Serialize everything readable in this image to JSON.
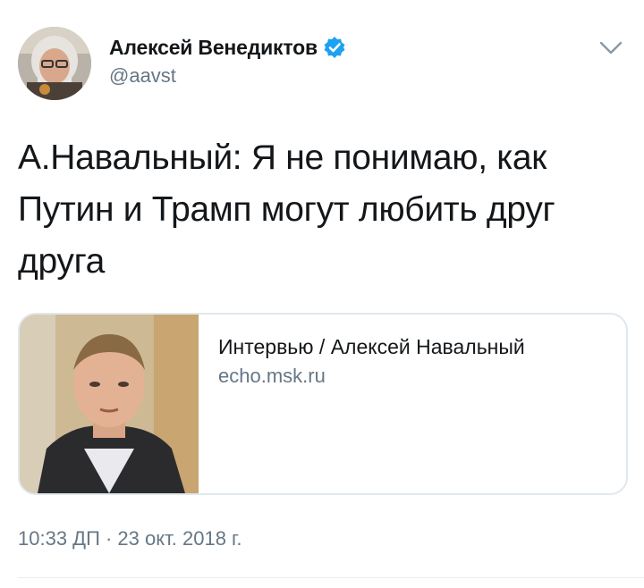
{
  "author": {
    "display_name": "Алексей Венедиктов",
    "handle": "@aavst",
    "verified": true,
    "avatar_icon": "avatar-photo"
  },
  "tweet": {
    "text_lines": [
      "А.Навальный:  Я не понимаю, как",
      "Путин и Трамп могут любить друг",
      "друга"
    ],
    "timestamp": "10:33 ДП · 23 окт. 2018 г."
  },
  "link_card": {
    "title": "Интервью / Алексей Навальный",
    "domain": "echo.msk.ru",
    "thumbnail_icon": "portrait-photo"
  },
  "menu": {
    "icon": "chevron-down-icon"
  },
  "colors": {
    "text": "#14171a",
    "secondary": "#657786",
    "verified_blue": "#1da1f2",
    "border": "#e1e8ed"
  }
}
